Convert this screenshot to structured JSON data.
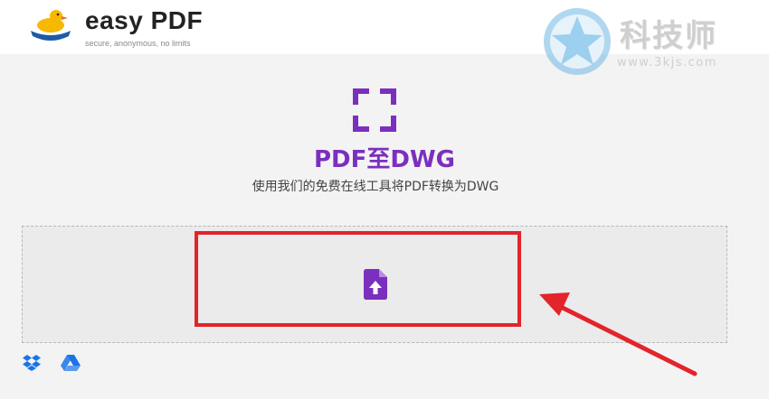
{
  "header": {
    "brand_name": "easy PDF",
    "tagline": "secure, anonymous, no limits",
    "logo_icon": "duck-logo-icon"
  },
  "watermark": {
    "text": "科技师",
    "url": "www.3kjs.com",
    "icon": "star-watermark-icon"
  },
  "main": {
    "tool_icon": "expand-corners-icon",
    "title": "PDF至DWG",
    "subtitle": "使用我们的免费在线工具将PDF转换为DWG",
    "upload_icon": "file-upload-icon",
    "cloud_sources": [
      "dropbox-icon",
      "google-drive-icon"
    ]
  },
  "colors": {
    "accent": "#7b2fbe",
    "highlight": "#e3242b",
    "background": "#f3f3f3"
  }
}
